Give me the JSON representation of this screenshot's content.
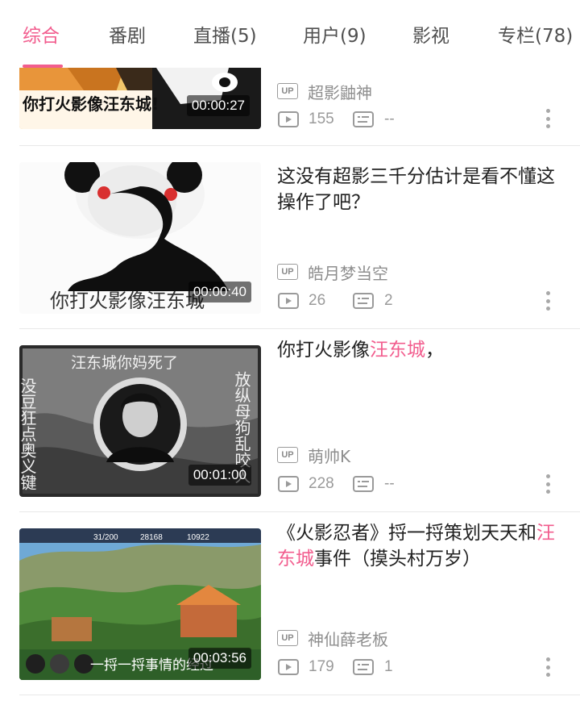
{
  "tabs": [
    {
      "label": "综合",
      "active": true
    },
    {
      "label": "番剧",
      "active": false
    },
    {
      "label": "直播(5)",
      "active": false
    },
    {
      "label": "用户(9)",
      "active": false
    },
    {
      "label": "影视",
      "active": false
    },
    {
      "label": "专栏(78)",
      "active": false
    }
  ],
  "colors": {
    "accent": "#f25d8e",
    "text": "#212121",
    "meta": "#9a9a9a"
  },
  "videos": [
    {
      "thumb_caption": "你打火影像汪东城!",
      "duration": "00:00:27",
      "title_parts": [],
      "uploader": "超影鼬神",
      "plays": "155",
      "danmaku": "--"
    },
    {
      "thumb_caption": "你打火影像汪东城",
      "duration": "00:00:40",
      "title_parts": [
        {
          "text": "这没有超影三千分估计是看不懂这操作了吧？",
          "hl": false
        }
      ],
      "uploader": "皓月梦当空",
      "plays": "26",
      "danmaku": "2"
    },
    {
      "thumb_caption": "汪东城你妈死了",
      "thumb_left": "没豆狂点奥义键",
      "thumb_right": "放纵母狗乱咬人",
      "duration": "00:01:00",
      "title_parts": [
        {
          "text": "你打火影像",
          "hl": false
        },
        {
          "text": "汪东城",
          "hl": true
        },
        {
          "text": "，",
          "hl": false
        }
      ],
      "uploader": "萌帅K",
      "plays": "228",
      "danmaku": "--"
    },
    {
      "thumb_caption": "一捋一捋事情的经过",
      "thumb_hud": [
        "31/200",
        "28168",
        "10922"
      ],
      "duration": "00:03:56",
      "title_parts": [
        {
          "text": "《火影忍者》捋一捋策划天天和",
          "hl": false
        },
        {
          "text": "汪东城",
          "hl": true
        },
        {
          "text": "事件（摸头村万岁）",
          "hl": false
        }
      ],
      "uploader": "神仙薛老板",
      "plays": "179",
      "danmaku": "1"
    }
  ],
  "labels": {
    "up_badge": "UP"
  },
  "icons": {
    "play": "play-count-icon",
    "danmaku": "danmaku-count-icon",
    "more": "more-vertical-icon"
  }
}
